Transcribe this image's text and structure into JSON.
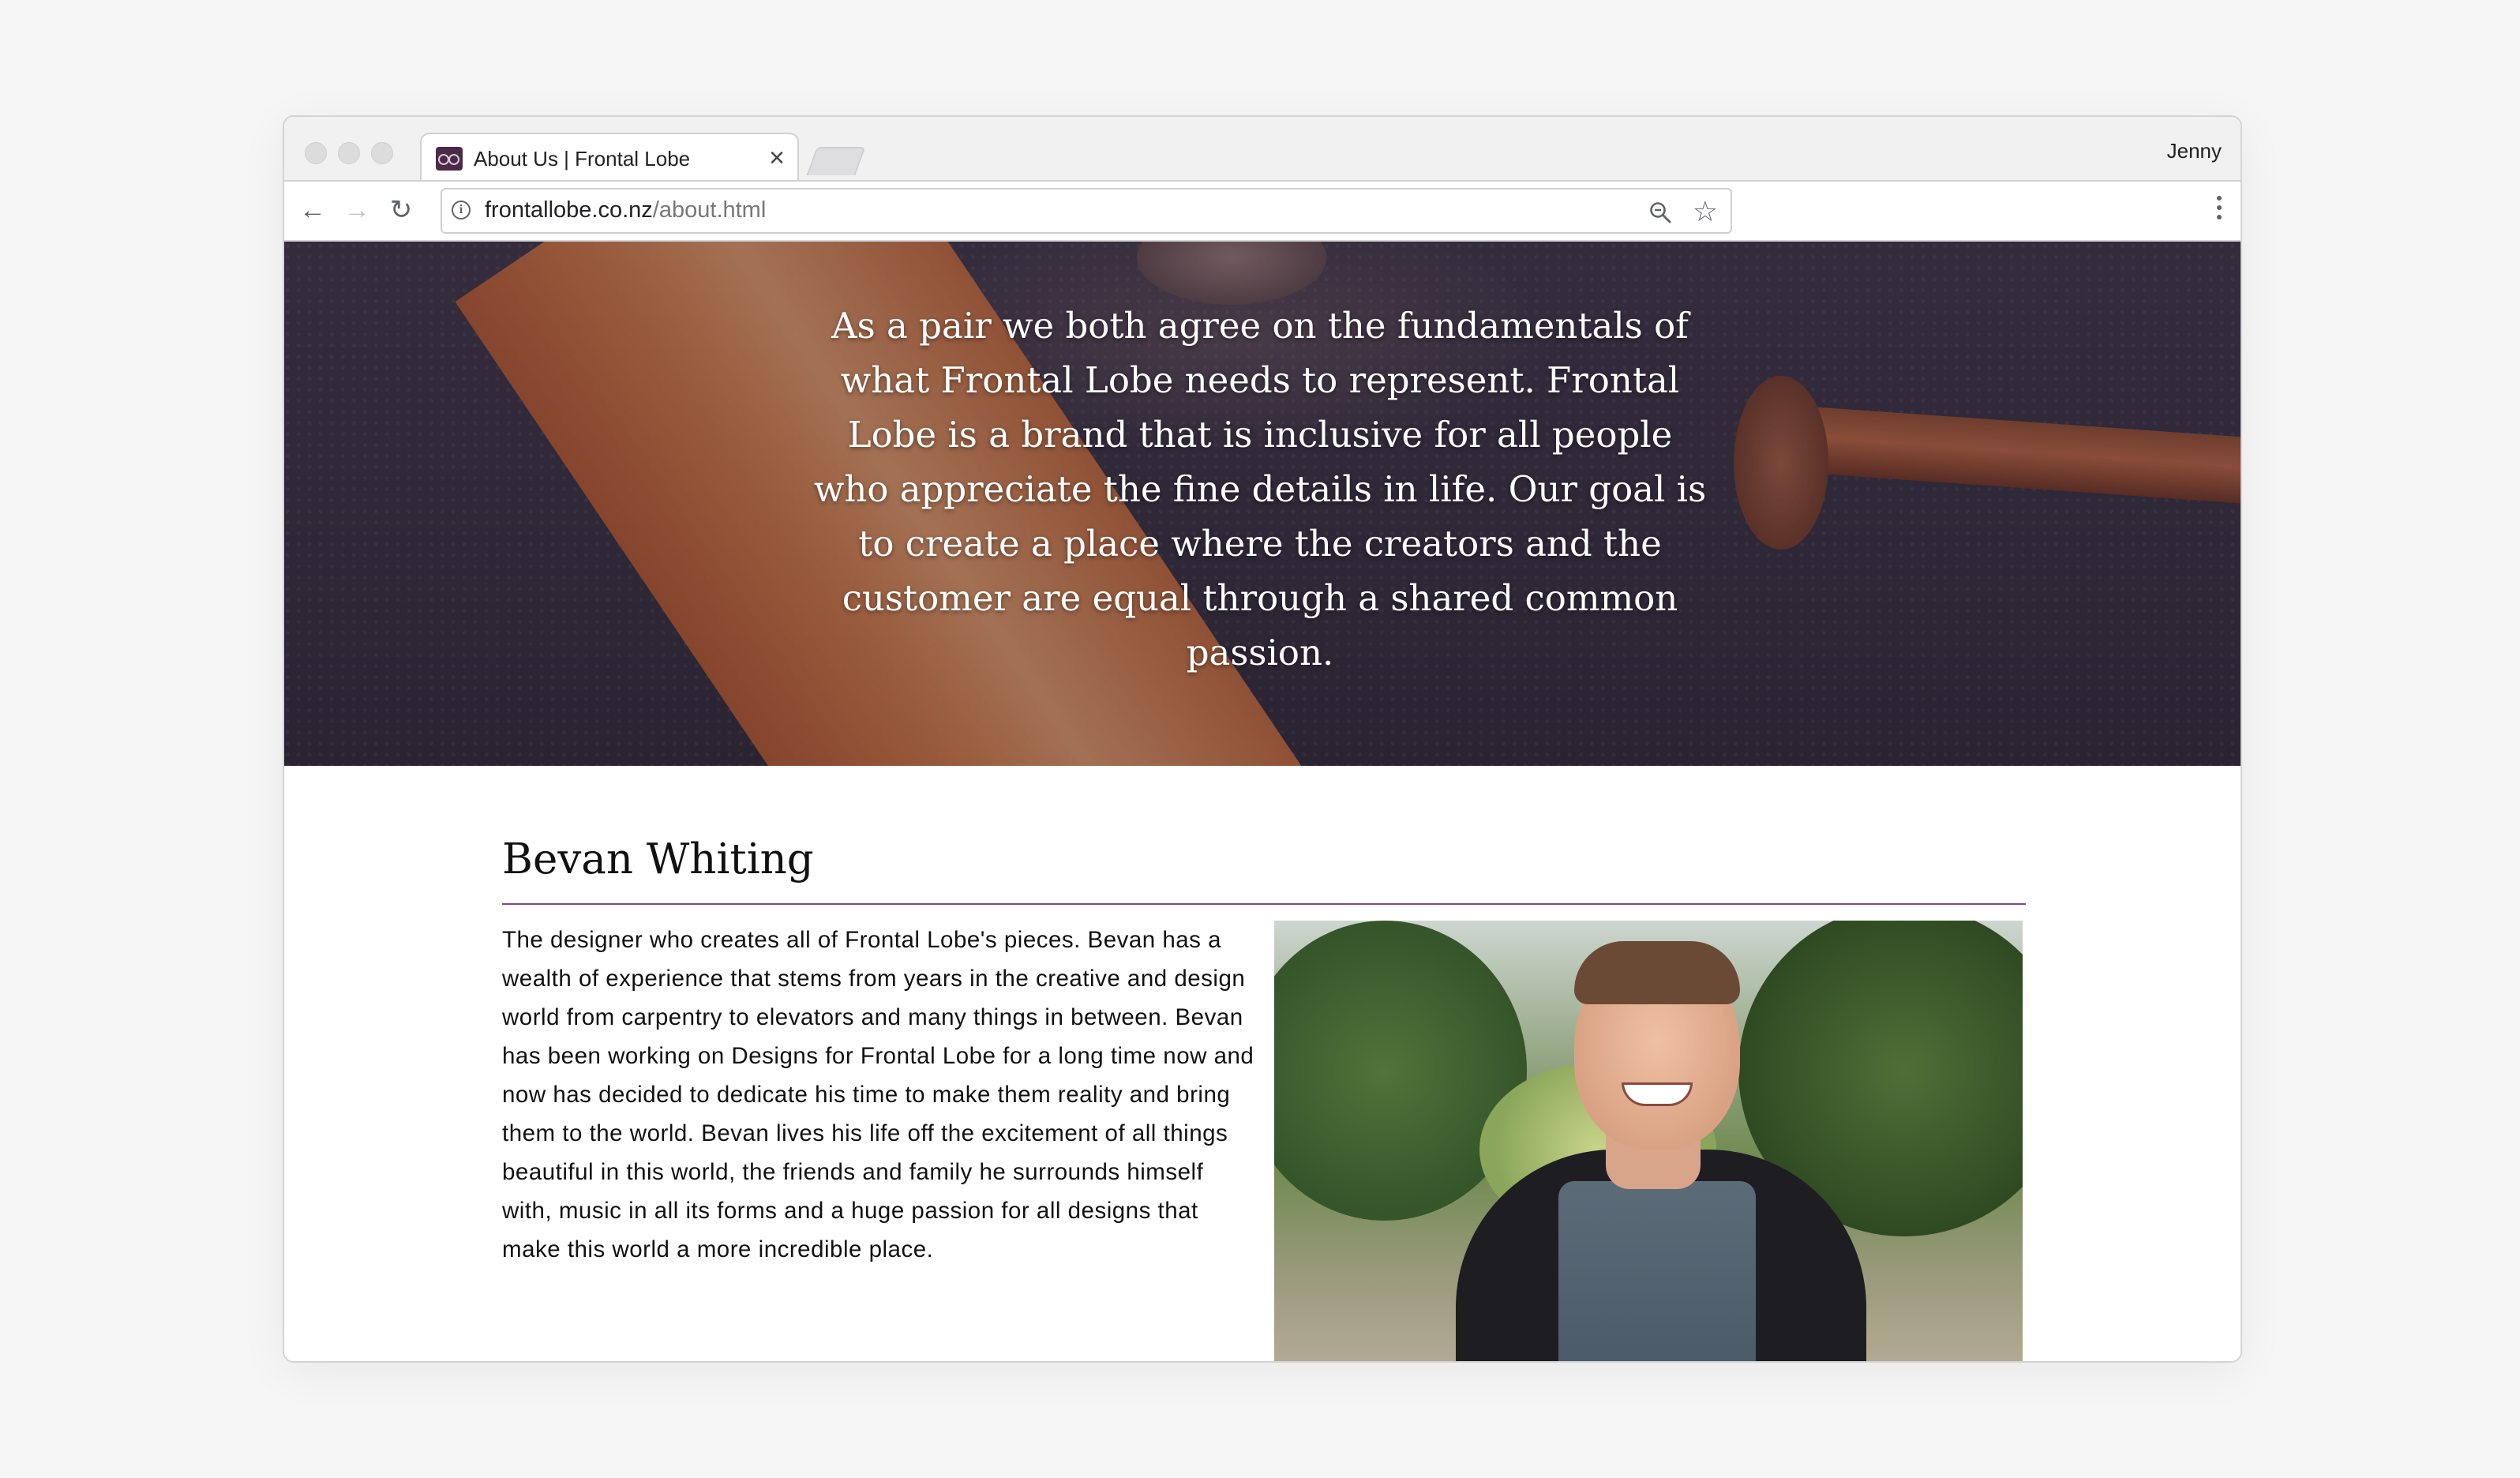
{
  "browser": {
    "tab_title": "About Us | Frontal Lobe",
    "tab_close": "×",
    "profile_name": "Jenny",
    "url_host": "frontallobe.co.nz",
    "url_path": "/about.html",
    "back_icon": "←",
    "forward_icon": "→",
    "reload_icon": "↻",
    "info_icon": "i",
    "star_icon": "☆"
  },
  "hero": {
    "quote": "As a pair we both agree on the fundamentals of what Frontal Lobe needs to represent. Frontal Lobe is a brand that is inclusive for all people who appreciate the fine details in life. Our goal is to create a place where the creators and the customer are equal through a shared common passion."
  },
  "profile": {
    "name": "Bevan Whiting",
    "bio": "The designer who creates all of Frontal Lobe's pieces. Bevan has a wealth of experience that stems from years in the creative and design world from carpentry to elevators and many things in between. Bevan has been working on Designs for Frontal Lobe for a long time now and now has decided to dedicate his time to make them reality and bring them to the world. Bevan lives his life off the excitement of all things beautiful in this world, the friends and family he surrounds himself with, music in all its forms and a huge passion for all designs that make this world a more incredible place."
  },
  "colors": {
    "accent_rule": "#7a4f78",
    "favicon": "#4b2a47"
  }
}
